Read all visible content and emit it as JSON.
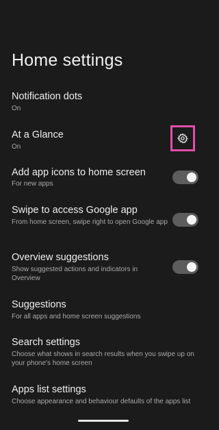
{
  "page": {
    "title": "Home settings"
  },
  "settings": [
    {
      "title": "Notification dots",
      "subtitle": "On"
    },
    {
      "title": "At a Glance",
      "subtitle": "On",
      "icon": "gear-icon"
    },
    {
      "title": "Add app icons to home screen",
      "subtitle": "For new apps",
      "toggle_on": true
    },
    {
      "title": "Swipe to access Google app",
      "subtitle": "From home screen, swipe right to open Google app",
      "toggle_on": true
    },
    {
      "title": "Overview suggestions",
      "subtitle": "Show suggested actions and indicators in Overview",
      "toggle_on": true
    },
    {
      "title": "Suggestions",
      "subtitle": "For all apps and home screen suggestions"
    },
    {
      "title": "Search settings",
      "subtitle": "Choose what shows in search results when you swipe up on your phone's home screen"
    },
    {
      "title": "Apps list settings",
      "subtitle": "Choose appearance and behaviour defaults of the apps list"
    }
  ],
  "colors": {
    "background": "#1b1b1b",
    "highlight": "#e34fa9",
    "toggle_track": "#5d5d5d"
  }
}
